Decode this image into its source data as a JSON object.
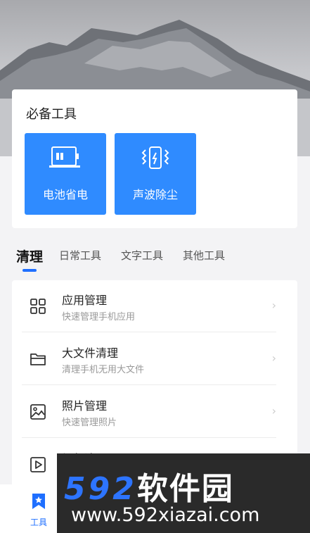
{
  "header_image": {
    "description_icon": "mountain-landscape-icon"
  },
  "essential_tools": {
    "title": "必备工具",
    "items": [
      {
        "label": "电池省电",
        "icon": "battery-icon"
      },
      {
        "label": "声波除尘",
        "icon": "phone-vibrate-icon"
      }
    ]
  },
  "tabs": [
    {
      "label": "清理",
      "active": true
    },
    {
      "label": "日常工具",
      "active": false
    },
    {
      "label": "文字工具",
      "active": false
    },
    {
      "label": "其他工具",
      "active": false
    }
  ],
  "list": [
    {
      "title": "应用管理",
      "subtitle": "快速管理手机应用",
      "icon": "grid-icon"
    },
    {
      "title": "大文件清理",
      "subtitle": "清理手机无用大文件",
      "icon": "folder-icon"
    },
    {
      "title": "照片管理",
      "subtitle": "快速管理照片",
      "icon": "image-icon"
    },
    {
      "title": "视频清理",
      "subtitle": "",
      "icon": "video-icon"
    }
  ],
  "chevron": "›",
  "bottom_nav": {
    "tools_label": "工具"
  },
  "watermark": {
    "line1_digits": "592",
    "line1_text": "软件园",
    "line2": "www.592xiazai.com"
  },
  "colors": {
    "accent": "#2f8bff",
    "tab_indicator": "#1f6fff"
  }
}
